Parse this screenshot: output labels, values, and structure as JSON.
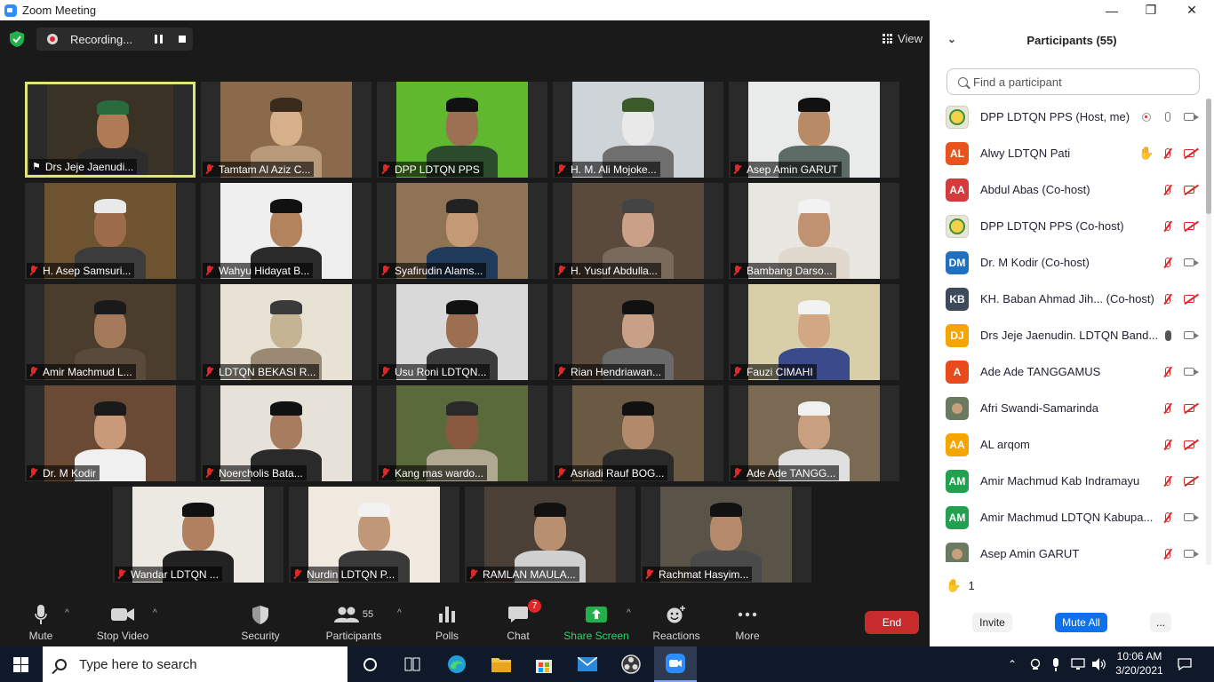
{
  "window": {
    "title": "Zoom Meeting",
    "minimize": "—",
    "maximize": "❐",
    "close": "✕"
  },
  "recording": {
    "label": "Recording..."
  },
  "view": {
    "label": "View"
  },
  "tiles": [
    {
      "name": "Drs Jeje Jaenudi...",
      "bg": "#3b3226",
      "skin": "#b07a56",
      "cap": "#2a6b3d",
      "body": "#2d2d2d",
      "pinned": true,
      "active": true
    },
    {
      "name": "Tamtam Al Aziz C...",
      "bg": "#8a6a4a",
      "skin": "#d6b08a",
      "cap": "#3a2a1c",
      "body": "#b89a7a",
      "pinned": false,
      "active": false
    },
    {
      "name": "DPP LDTQN PPS",
      "bg": "#5fb82d",
      "skin": "#9c7052",
      "cap": "#111",
      "body": "#2c4a2c",
      "pinned": false,
      "active": false
    },
    {
      "name": "H. M. Ali Mojoke...",
      "bg": "#cfd4d8",
      "skin": "#e9e9e9",
      "cap": "#3a5a2a",
      "body": "#6f6f6f",
      "pinned": false,
      "active": false
    },
    {
      "name": "Asep Amin GARUT",
      "bg": "#e9eaea",
      "skin": "#b88a66",
      "cap": "#111",
      "body": "#5c6b66",
      "pinned": false,
      "active": false
    },
    {
      "name": "H. Asep Samsuri...",
      "bg": "#6e5330",
      "skin": "#9c6b4b",
      "cap": "#e9e9e9",
      "body": "#3c3c3c",
      "pinned": false,
      "active": false
    },
    {
      "name": "Wahyu Hidayat B...",
      "bg": "#efefef",
      "skin": "#b3835d",
      "cap": "#111",
      "body": "#2a2a2a",
      "pinned": false,
      "active": false
    },
    {
      "name": "Syafirudin Alams...",
      "bg": "#8e7455",
      "skin": "#c49a76",
      "cap": "#222",
      "body": "#1f3a5a",
      "pinned": false,
      "active": false
    },
    {
      "name": "H. Yusuf Abdulla...",
      "bg": "#5a4a3c",
      "skin": "#c9a088",
      "cap": "#444",
      "body": "#7a6a5a",
      "pinned": false,
      "active": false
    },
    {
      "name": "Bambang Darso...",
      "bg": "#e8e6e0",
      "skin": "#c09272",
      "cap": "#f2f2f2",
      "body": "#e0d8cc",
      "pinned": false,
      "active": false
    },
    {
      "name": "Amir Machmud L...",
      "bg": "#4b3d2e",
      "skin": "#a47a5a",
      "cap": "#1a1a1a",
      "body": "#5a4a3a",
      "pinned": false,
      "active": false
    },
    {
      "name": "LDTQN BEKASI R...",
      "bg": "#e8e2d4",
      "skin": "#c4b494",
      "cap": "#3a3a3a",
      "body": "#9a8a74",
      "pinned": false,
      "active": false
    },
    {
      "name": "Usu Roni LDTQN...",
      "bg": "#d9d9d9",
      "skin": "#9c6e52",
      "cap": "#111",
      "body": "#3b3b3b",
      "pinned": false,
      "active": false
    },
    {
      "name": "Rian Hendriawan...",
      "bg": "#5a4a3c",
      "skin": "#c8a086",
      "cap": "#111",
      "body": "#6a6a6a",
      "pinned": false,
      "active": false
    },
    {
      "name": "Fauzi CIMAHI",
      "bg": "#d8cfa8",
      "skin": "#d2a884",
      "cap": "#f2f2f2",
      "body": "#3a4a8a",
      "pinned": false,
      "active": false
    },
    {
      "name": "Dr. M Kodir",
      "bg": "#6a4a34",
      "skin": "#c89a7a",
      "cap": "#1a1a1a",
      "body": "#f0f0f0",
      "pinned": false,
      "active": false
    },
    {
      "name": "Noercholis Bata...",
      "bg": "#e6e2da",
      "skin": "#a87c5e",
      "cap": "#111",
      "body": "#2a2a2a",
      "pinned": false,
      "active": false
    },
    {
      "name": "Kang mas wardo...",
      "bg": "#5a6a3a",
      "skin": "#8a5a40",
      "cap": "#2a2a2a",
      "body": "#b0a890",
      "pinned": false,
      "active": false
    },
    {
      "name": "Asriadi Rauf BOG...",
      "bg": "#6a5a44",
      "skin": "#b08a6a",
      "cap": "#111",
      "body": "#2a2a2a",
      "pinned": false,
      "active": false
    },
    {
      "name": "Ade Ade TANGG...",
      "bg": "#7a6a54",
      "skin": "#c8a080",
      "cap": "#f0f0f0",
      "body": "#e0e0e0",
      "pinned": false,
      "active": false
    },
    {
      "name": "Wandar LDTQN ...",
      "bg": "#ece8e2",
      "skin": "#b08060",
      "cap": "#111",
      "body": "#222",
      "pinned": false,
      "active": false
    },
    {
      "name": "Nurdin LDTQN P...",
      "bg": "#efe9e0",
      "skin": "#c09878",
      "cap": "#f2f2f2",
      "body": "#3a3a3a",
      "pinned": false,
      "active": false
    },
    {
      "name": "RAMLAN MAULA...",
      "bg": "#4a4038",
      "skin": "#b89070",
      "cap": "#111",
      "body": "#d0d0d0",
      "pinned": false,
      "active": false
    },
    {
      "name": "Rachmat Hasyim...",
      "bg": "#5a5448",
      "skin": "#b48a6a",
      "cap": "#111",
      "body": "#4a4a4a",
      "pinned": false,
      "active": false
    }
  ],
  "toolbar": {
    "mute": "Mute",
    "stop_video": "Stop Video",
    "security": "Security",
    "participants": "Participants",
    "participants_count": "55",
    "polls": "Polls",
    "chat": "Chat",
    "chat_badge": "7",
    "share_screen": "Share Screen",
    "reactions": "Reactions",
    "more": "More",
    "end": "End"
  },
  "panel": {
    "title": "Participants (55)",
    "search_placeholder": "Find a participant",
    "participants": [
      {
        "name": "DPP LDTQN PPS (Host, me)",
        "initials": "",
        "avatar": "logo",
        "color": "",
        "mic": "on",
        "cam": "on",
        "rec": true,
        "hand": false
      },
      {
        "name": "Alwy LDTQN Pati",
        "initials": "AL",
        "avatar": "initials",
        "color": "#e8541c",
        "mic": "off",
        "cam": "off",
        "rec": false,
        "hand": true
      },
      {
        "name": "Abdul Abas (Co-host)",
        "initials": "AA",
        "avatar": "initials",
        "color": "#d23c3c",
        "mic": "off",
        "cam": "off",
        "rec": false,
        "hand": false
      },
      {
        "name": "DPP LDTQN PPS (Co-host)",
        "initials": "",
        "avatar": "logo",
        "color": "",
        "mic": "off",
        "cam": "off",
        "rec": false,
        "hand": false
      },
      {
        "name": "Dr. M Kodir (Co-host)",
        "initials": "DM",
        "avatar": "initials",
        "color": "#2170c0",
        "mic": "off",
        "cam": "on",
        "rec": false,
        "hand": false
      },
      {
        "name": "KH. Baban Ahmad Jih...  (Co-host)",
        "initials": "KB",
        "avatar": "initials",
        "color": "#3c4a5c",
        "mic": "off",
        "cam": "off",
        "rec": false,
        "hand": false
      },
      {
        "name": "Drs Jeje Jaenudin. LDTQN  Band...",
        "initials": "DJ",
        "avatar": "initials",
        "color": "#f5a400",
        "mic": "live",
        "cam": "on",
        "rec": false,
        "hand": false
      },
      {
        "name": "Ade Ade TANGGAMUS",
        "initials": "A",
        "avatar": "initials",
        "color": "#e84a1c",
        "mic": "off",
        "cam": "on",
        "rec": false,
        "hand": false
      },
      {
        "name": "Afri Swandi-Samarinda",
        "initials": "",
        "avatar": "photo",
        "color": "",
        "mic": "off",
        "cam": "off",
        "rec": false,
        "hand": false
      },
      {
        "name": "AL arqom",
        "initials": "AA",
        "avatar": "initials",
        "color": "#f5a400",
        "mic": "off",
        "cam": "off",
        "rec": false,
        "hand": false
      },
      {
        "name": "Amir Machmud Kab Indramayu",
        "initials": "AM",
        "avatar": "initials",
        "color": "#1fa150",
        "mic": "off",
        "cam": "off",
        "rec": false,
        "hand": false
      },
      {
        "name": "Amir Machmud LDTQN Kabupa...",
        "initials": "AM",
        "avatar": "initials",
        "color": "#1fa150",
        "mic": "off",
        "cam": "on",
        "rec": false,
        "hand": false
      },
      {
        "name": "Asep Amin GARUT",
        "initials": "",
        "avatar": "photo",
        "color": "",
        "mic": "off",
        "cam": "on",
        "rec": false,
        "hand": false
      }
    ],
    "raised_count": "1",
    "invite": "Invite",
    "mute_all": "Mute All",
    "more": "..."
  },
  "taskbar": {
    "search_placeholder": "Type here to search",
    "time": "10:06 AM",
    "date": "3/20/2021"
  }
}
